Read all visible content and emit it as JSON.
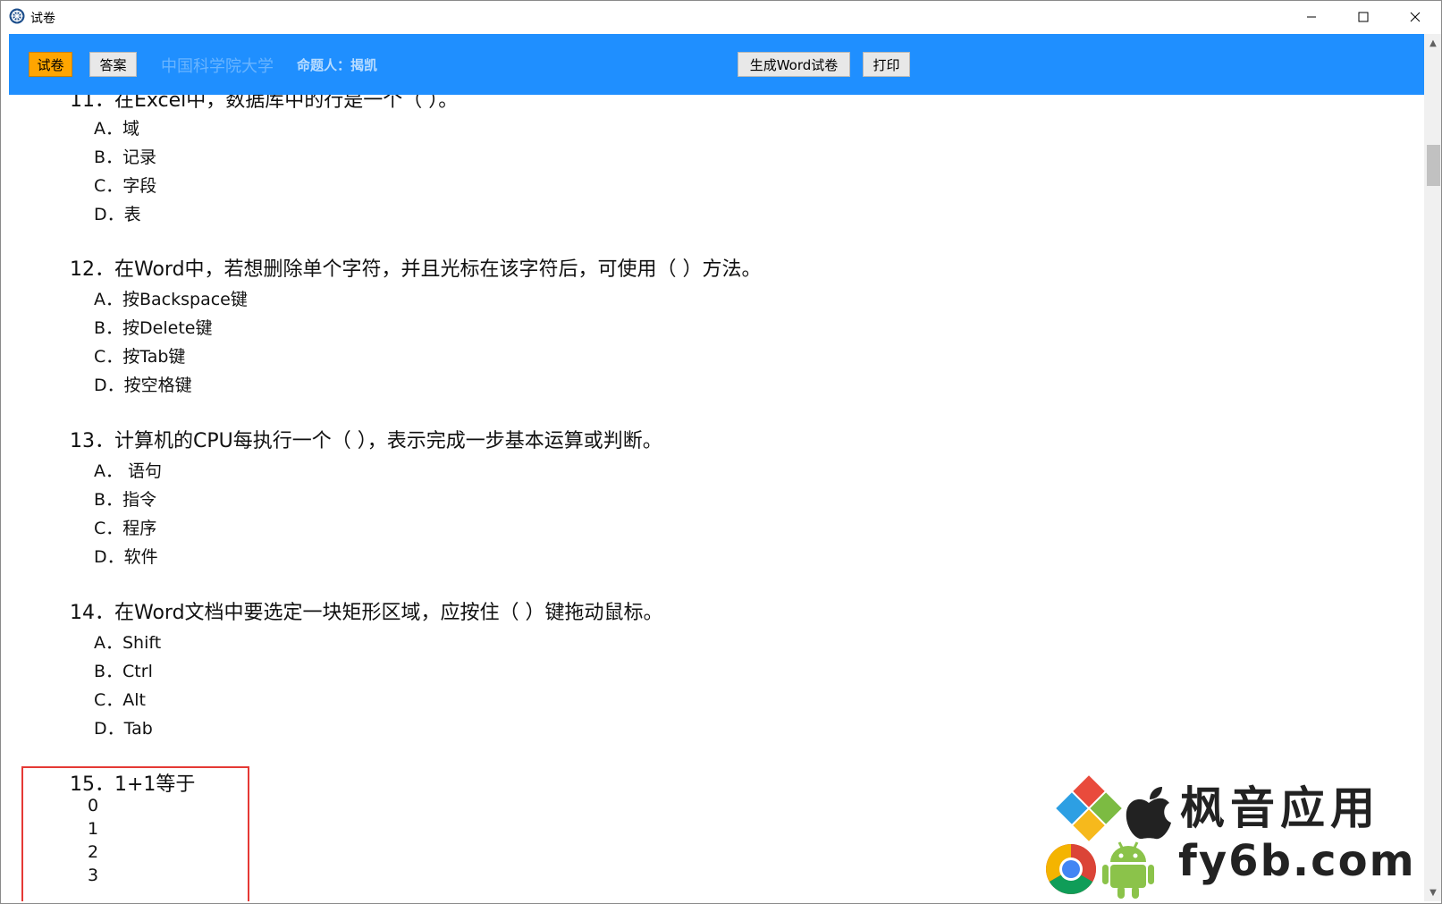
{
  "window": {
    "title": "试卷",
    "minimize": "—",
    "maximize": "☐",
    "close": "✕"
  },
  "toolbar": {
    "paper_label": "试卷",
    "answer_label": "答案",
    "school": "中国科学院大学",
    "setter": "命题人：揭凯",
    "word_label": "生成Word试卷",
    "print_label": "打印"
  },
  "questions": [
    {
      "text": "11．在Excel中，数据库中的行是一个（ ）。",
      "options": [
        "A．域",
        "B．记录",
        "C．字段",
        "D．表"
      ]
    },
    {
      "text": "12．在Word中，若想删除单个字符，并且光标在该字符后，可使用（ ）方法。",
      "options": [
        "A．按Backspace键",
        "B．按Delete键",
        "C．按Tab键",
        "D．按空格键"
      ]
    },
    {
      "text": "13．计算机的CPU每执行一个（ ），表示完成一步基本运算或判断。",
      "options": [
        "A． 语句",
        "B．指令",
        "C．程序",
        "D．软件"
      ]
    },
    {
      "text": "14．在Word文档中要选定一块矩形区域，应按住（ ）键拖动鼠标。",
      "options": [
        "A．Shift",
        "B．Ctrl",
        "C．Alt",
        "D．Tab"
      ]
    },
    {
      "text": "15．1+1等于",
      "options": [
        "0",
        "1",
        "2",
        "3"
      ]
    }
  ],
  "watermark": {
    "brand": "枫音应用",
    "domain": "fy6b.com"
  },
  "colors": {
    "toolbar": "#1f8fff",
    "paper_button": "#ffa500",
    "highlight": "#e53935"
  }
}
